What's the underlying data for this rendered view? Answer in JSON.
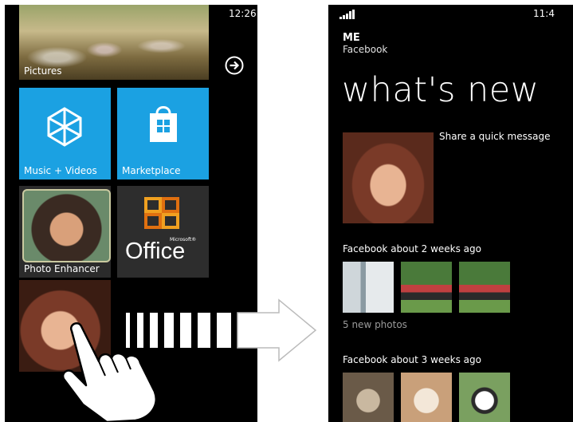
{
  "left_phone": {
    "time": "12:26",
    "tiles": {
      "pictures": "Pictures",
      "music_videos": "Music + Videos",
      "marketplace": "Marketplace",
      "photo_enhancer": "Photo Enhancer",
      "office": "Office",
      "office_brand": "Microsoft®"
    },
    "icons": {
      "arrow": "arrow-right-circle-icon",
      "music": "zune-icon",
      "marketplace": "shopping-bag-icon",
      "office": "office-logo-icon"
    },
    "accent_color": "#1ba1e2"
  },
  "right_phone": {
    "time": "11:4",
    "profile_name": "ME",
    "profile_source": "Facebook",
    "page_title": "what's new",
    "share_prompt": "Share a quick message",
    "sections": [
      {
        "heading": "Facebook about 2 weeks ago",
        "note": "5 new photos"
      },
      {
        "heading": "Facebook about 3 weeks ago"
      }
    ]
  }
}
